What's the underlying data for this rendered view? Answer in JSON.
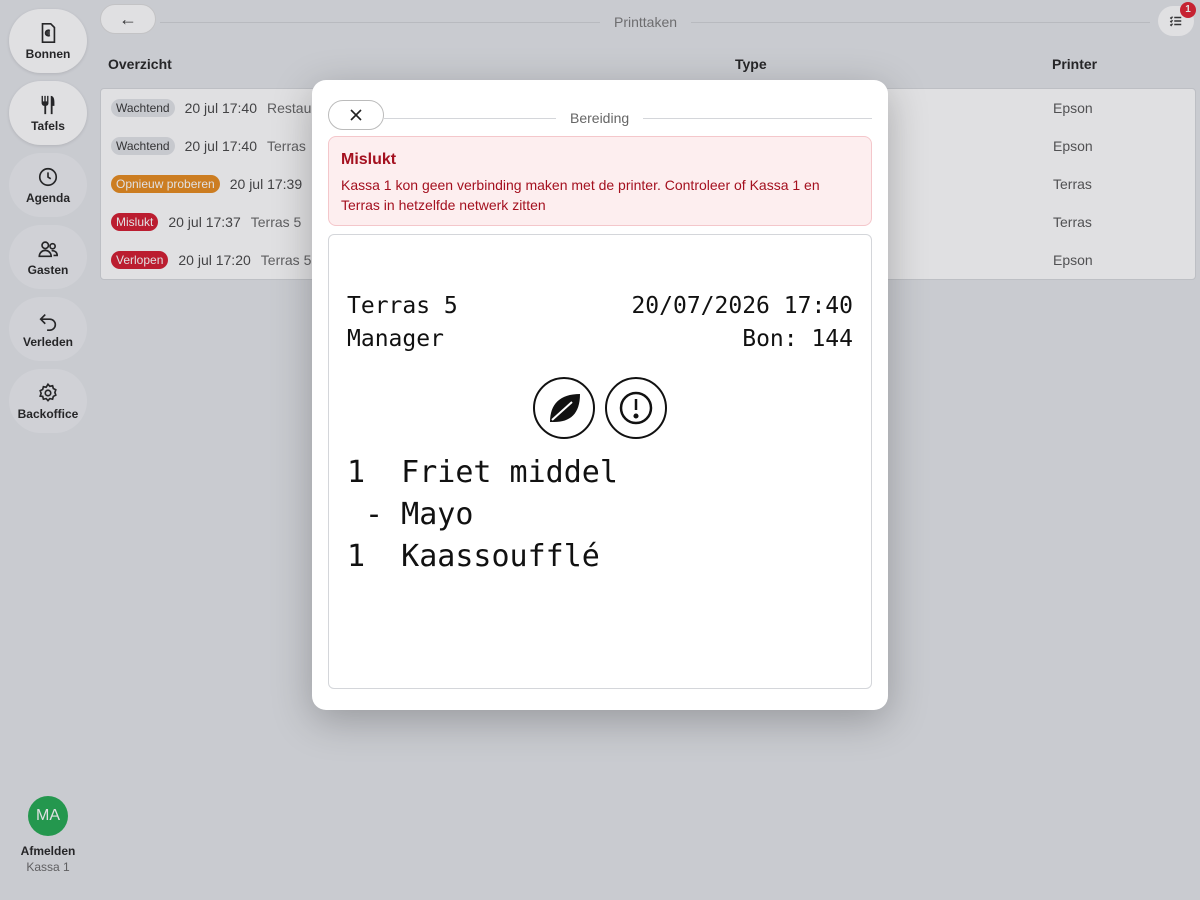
{
  "sidebar": {
    "items": [
      {
        "label": "Bonnen",
        "icon": "receipt-euro-icon"
      },
      {
        "label": "Tafels",
        "icon": "cutlery-icon"
      },
      {
        "label": "Agenda",
        "icon": "clock-icon"
      },
      {
        "label": "Gasten",
        "icon": "users-icon"
      },
      {
        "label": "Verleden",
        "icon": "undo-icon"
      },
      {
        "label": "Backoffice",
        "icon": "gear-icon"
      }
    ],
    "user": {
      "initials": "MA",
      "logout_label": "Afmelden",
      "register": "Kassa 1"
    }
  },
  "header": {
    "back_label": "←",
    "title": "Printtaken",
    "tasks_badge": "1"
  },
  "table": {
    "columns": {
      "overview": "Overzicht",
      "type": "Type",
      "printer": "Printer"
    },
    "rows": [
      {
        "status": "Wachtend",
        "status_color": "#e2e4e8",
        "time": "20 jul 17:40",
        "location": "Restau",
        "printer": "Epson"
      },
      {
        "status": "Wachtend",
        "status_color": "#e2e4e8",
        "time": "20 jul 17:40",
        "location": "Terras",
        "printer": "Epson"
      },
      {
        "status": "Opnieuw proberen",
        "status_color": "#e8891a",
        "time": "20 jul 17:39",
        "location": "",
        "printer": "Terras"
      },
      {
        "status": "Mislukt",
        "status_color": "#d3172b",
        "time": "20 jul 17:37",
        "location": "Terras 5",
        "printer": "Terras"
      },
      {
        "status": "Verlopen",
        "status_color": "#d3172b",
        "time": "20 jul 17:20",
        "location": "Terras 5",
        "printer": "Epson"
      }
    ]
  },
  "modal": {
    "title": "Bereiding",
    "alert": {
      "title": "Mislukt",
      "message": "Kassa 1 kon geen verbinding maken met de printer. Controleer of Kassa 1 en Terras in hetzelfde netwerk zitten"
    },
    "ticket": {
      "table": "Terras 5",
      "datetime": "20/07/2026 17:40",
      "user": "Manager",
      "bon": "Bon: 144",
      "icons": [
        "leaf-icon",
        "alert-circle-icon"
      ],
      "lines": [
        {
          "text": "1  Friet middel"
        },
        {
          "text": " - Mayo"
        },
        {
          "text": "1  Kaassoufflé"
        }
      ]
    }
  }
}
